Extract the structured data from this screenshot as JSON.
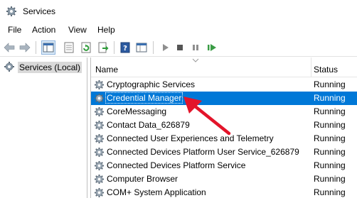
{
  "window": {
    "title": "Services",
    "icon": "gear-icon"
  },
  "menu": [
    "File",
    "Action",
    "View",
    "Help"
  ],
  "toolbar": {
    "buttons": [
      "back-arrow-icon",
      "forward-arrow-icon",
      "show-hide-console-tree-icon",
      "properties-icon",
      "refresh-icon",
      "export-list-icon",
      "help-icon",
      "extended-view-icon",
      "start-service-icon",
      "stop-service-icon",
      "pause-service-icon",
      "restart-service-icon"
    ]
  },
  "tree": {
    "root_label": "Services (Local)"
  },
  "table": {
    "columns": {
      "name": "Name",
      "status": "Status"
    },
    "rows": [
      {
        "name": "Cryptographic Services",
        "status": "Running"
      },
      {
        "name": "Credential Manager",
        "status": "Running",
        "selected": true
      },
      {
        "name": "CoreMessaging",
        "status": "Running"
      },
      {
        "name": "Contact Data_626879",
        "status": "Running"
      },
      {
        "name": "Connected User Experiences and Telemetry",
        "status": "Running"
      },
      {
        "name": "Connected Devices Platform User Service_626879",
        "status": "Running"
      },
      {
        "name": "Connected Devices Platform Service",
        "status": "Running"
      },
      {
        "name": "Computer Browser",
        "status": "Running"
      },
      {
        "name": "COM+ System Application",
        "status": "Running"
      }
    ]
  },
  "colors": {
    "selection": "#0078d7",
    "annotation_arrow": "#e3142a"
  }
}
